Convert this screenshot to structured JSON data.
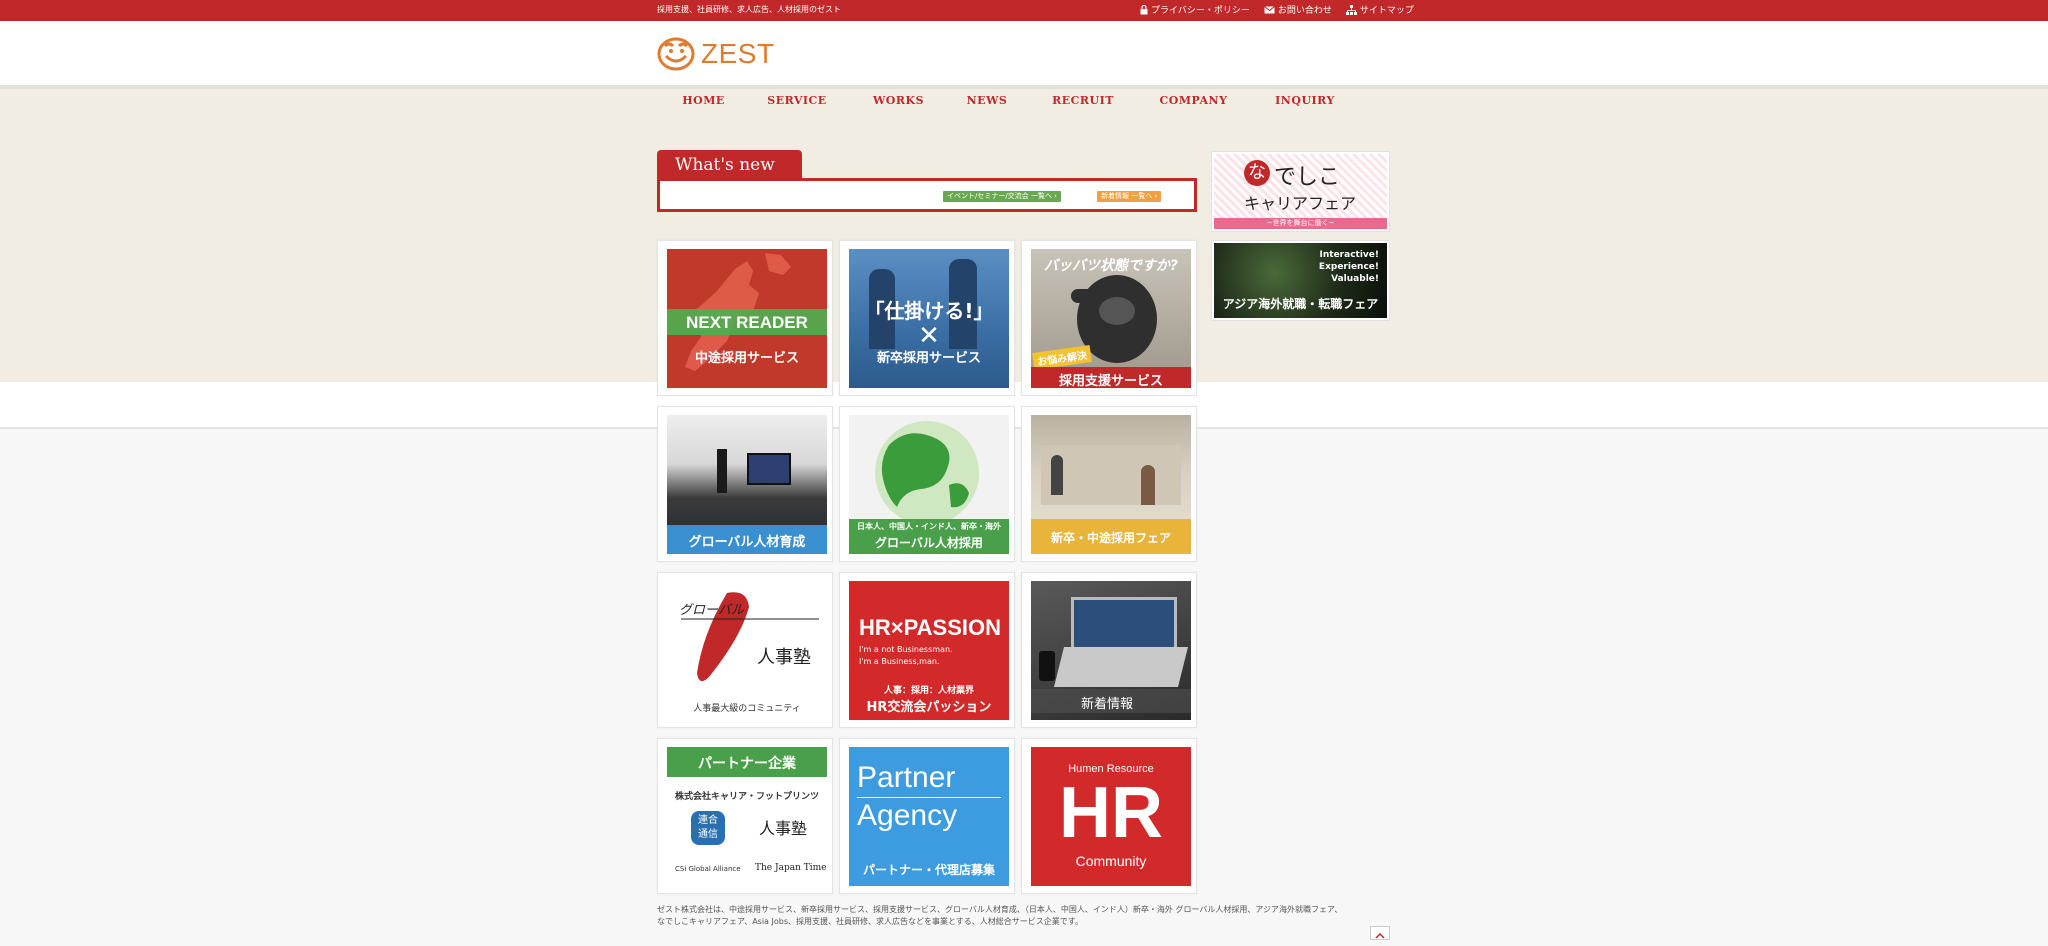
{
  "topbar": {
    "tagline": "採用支援、社員研修、求人広告、人材採用のゼスト",
    "links": {
      "privacy": "プライバシー・ポリシー",
      "contact": "お問い合わせ",
      "sitemap": "サイトマップ"
    },
    "icons": [
      "lock-icon",
      "mail-icon",
      "sitemap-icon"
    ]
  },
  "logo": {
    "word": "ZEST"
  },
  "nav": [
    "HOME",
    "SERVICE",
    "WORKS",
    "NEWS",
    "RECRUIT",
    "COMPANY",
    "INQUIRY"
  ],
  "whats_new": {
    "title": "What's new",
    "event_button": "イベント/セミナー/交流会 一覧へ ›",
    "news_button": "新着情報 一覧へ ›"
  },
  "tiles": {
    "next_reader": {
      "title": "NEXT READER",
      "caption": "中途採用サービス"
    },
    "shikakeru": {
      "title": "「仕掛ける!」",
      "symbol": "✕",
      "caption": "新卒採用サービス"
    },
    "gorilla": {
      "title": "バッバツ状態ですか?",
      "badge": "お悩み解決",
      "caption": "採用支援サービス"
    },
    "global_training": {
      "caption": "グローバル人材育成"
    },
    "global_hiring": {
      "subcaption": "日本人、中国人・インド人、新卒・海外",
      "caption": "グローバル人材採用"
    },
    "fair": {
      "caption": "新卒・中途採用フェア"
    },
    "global_jinji": {
      "brush": "グローバル",
      "brush2": "人事塾",
      "caption": "人事最大級のコミュニティ"
    },
    "hr_passion": {
      "title": "HR×PASSION",
      "line1": "I'm a not Businessman.",
      "line2": "I'm a Business,man.",
      "sub": "人事：採用：人材業界",
      "caption": "HR交流会パッション"
    },
    "news": {
      "caption": "新着情報"
    },
    "partners": {
      "title": "パートナー企業",
      "company": "株式会社キャリア・フットプリンツ",
      "badge": "連合\n通信",
      "brush": "人事塾",
      "alliance": "CSi Global Alliance",
      "times": "The Japan Times"
    },
    "partner_agency": {
      "line1": "Partner",
      "line2": "Agency",
      "caption": "パートナー・代理店募集"
    },
    "hr_community": {
      "top": "Humen Resource",
      "big": "HR",
      "bottom": "Community"
    }
  },
  "side": {
    "nadeshiko": {
      "title_na": "な",
      "title_rest": "でしこ",
      "line2": "キャリアフェア",
      "sub": "~世界を舞台に働く~"
    },
    "asia": {
      "tag1": "Interactive!",
      "tag2": "Experience!",
      "tag3": "Valuable!",
      "caption": "アジア海外就職・転職フェア"
    }
  },
  "footer": {
    "line1": "ゼスト株式会社は、中途採用サービス、新卒採用サービス、採用支援サービス、グローバル人材育成、（日本人、中国人、インド人）新卒・海外 グローバル人材採用、アジア海外就職フェア、",
    "line2": "なでしこキャリアフェア、Asia Jobs、採用支援、社員研修、求人広告などを事業とする、人材総合サービス企業です。"
  },
  "colors": {
    "brand_red": "#c0282a",
    "logo_orange": "#e07a2e",
    "band_beige": "#f1ede3"
  }
}
